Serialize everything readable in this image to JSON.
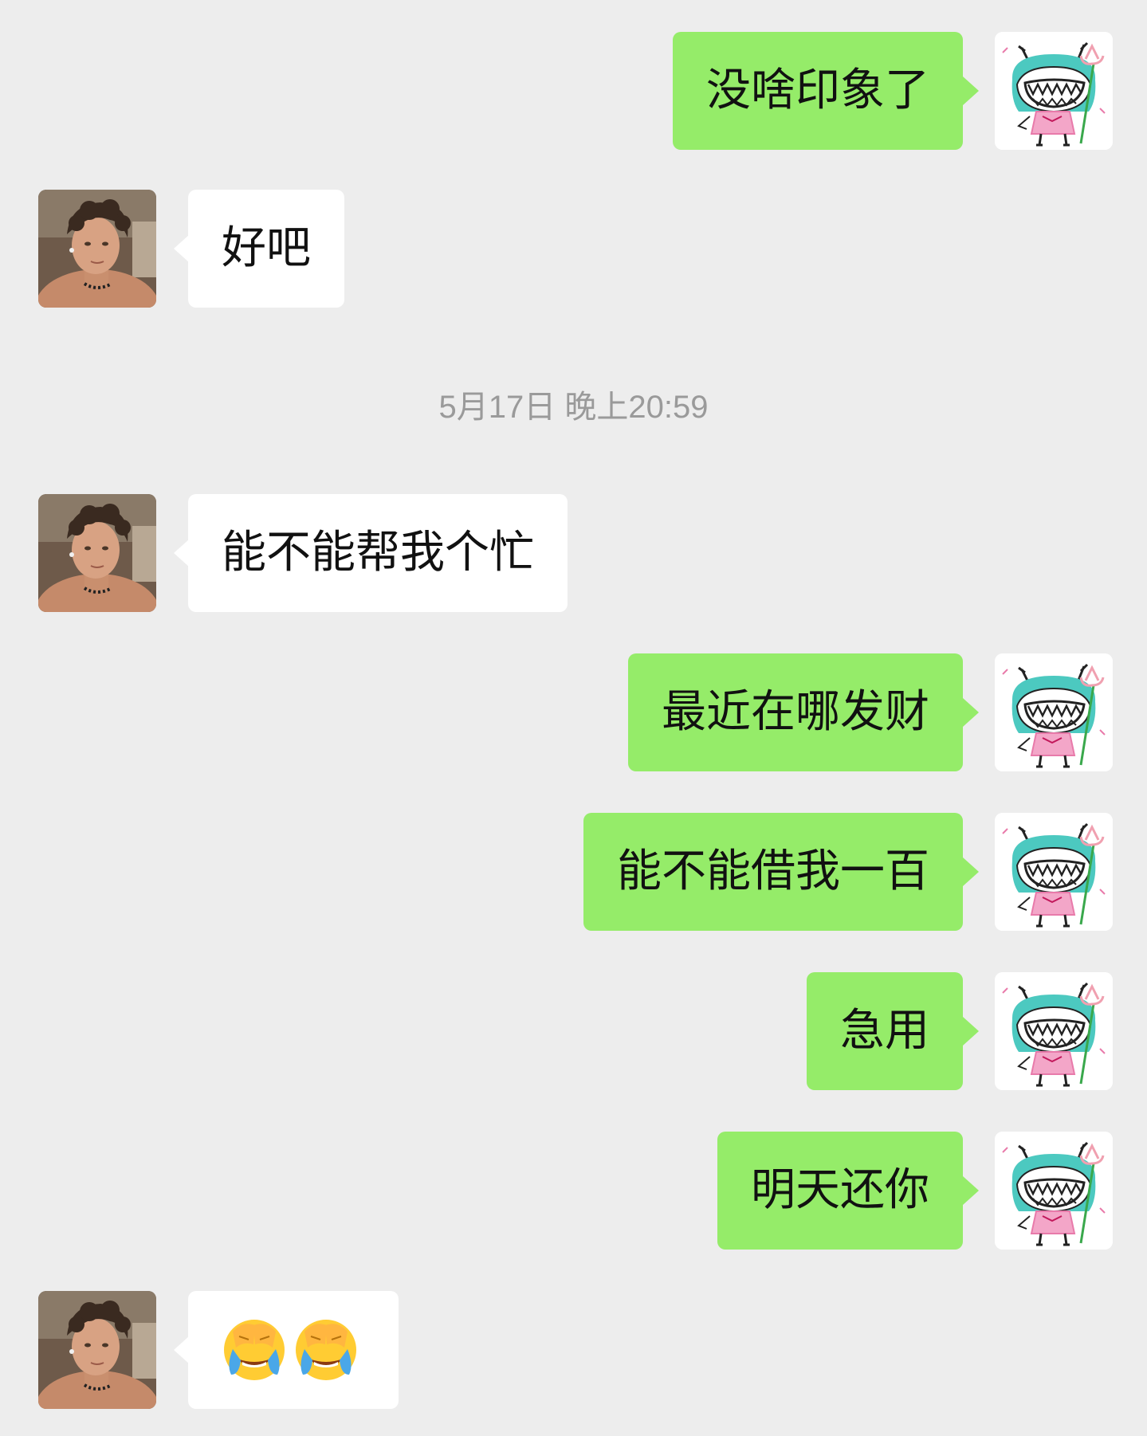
{
  "messages": [
    {
      "side": "out",
      "text": "没啥印象了",
      "avatar": "drawn-devil-girl-avatar"
    },
    {
      "side": "in",
      "text": "好吧",
      "avatar": "curly-hair-man-photo-avatar"
    },
    {
      "side": "in",
      "text": "能不能帮我个忙",
      "avatar": "curly-hair-man-photo-avatar"
    },
    {
      "side": "out",
      "text": "最近在哪发财",
      "avatar": "drawn-devil-girl-avatar"
    },
    {
      "side": "out",
      "text": "能不能借我一百",
      "avatar": "drawn-devil-girl-avatar"
    },
    {
      "side": "out",
      "text": "急用",
      "avatar": "drawn-devil-girl-avatar"
    },
    {
      "side": "out",
      "text": "明天还你",
      "avatar": "drawn-devil-girl-avatar"
    },
    {
      "side": "in",
      "emoji": [
        "crying-face-palm-emoji",
        "crying-face-palm-emoji"
      ],
      "avatar": "curly-hair-man-photo-avatar"
    }
  ],
  "timestamp": "5月17日 晚上20:59",
  "colors": {
    "background": "#ededed",
    "outgoing_bubble": "#95ec69",
    "incoming_bubble": "#ffffff",
    "timestamp_text": "#9a9a9a"
  }
}
